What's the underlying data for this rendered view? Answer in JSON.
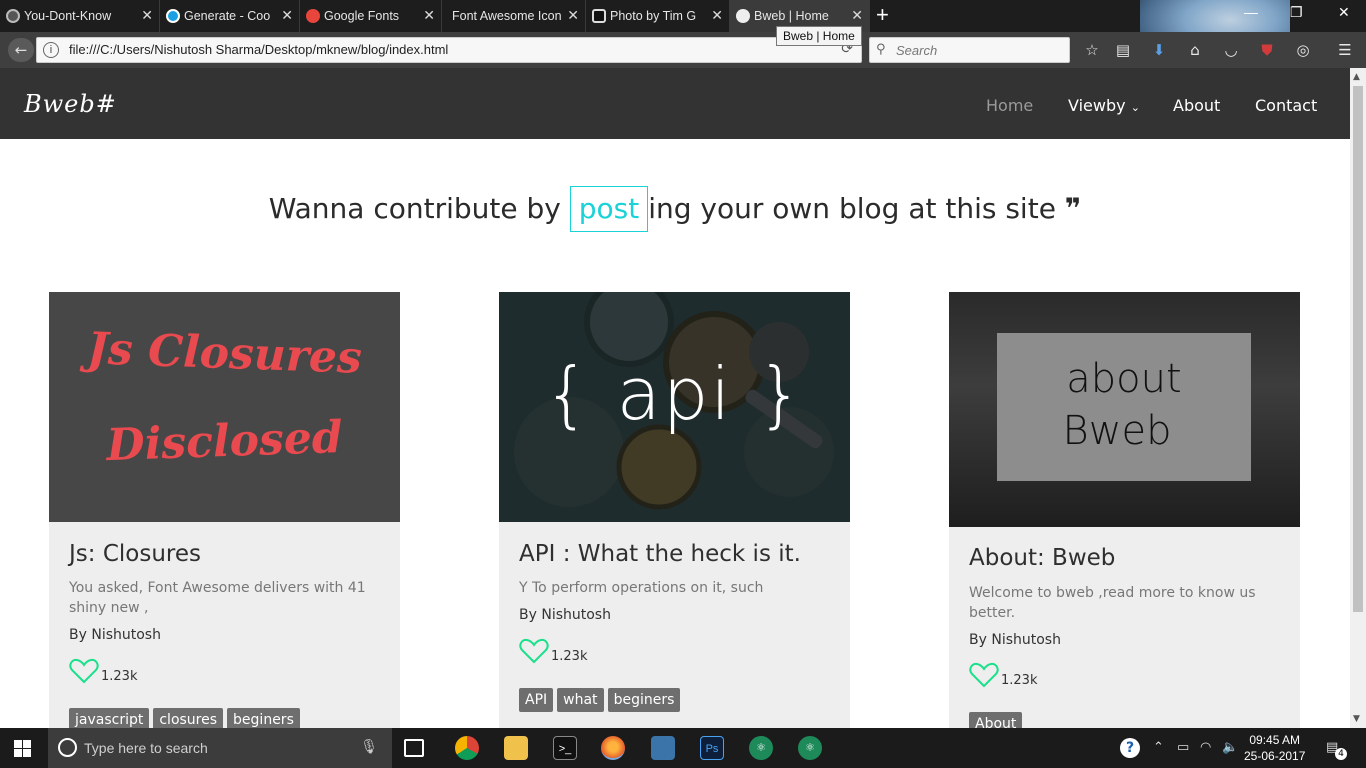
{
  "browser": {
    "tabs": [
      {
        "label": "You-Dont-Know",
        "favicon_color": "#222222"
      },
      {
        "label": "Generate - Coo",
        "favicon_color": "#1ba1e2"
      },
      {
        "label": "Google Fonts",
        "favicon_color": "#e8453c"
      },
      {
        "label": "Font Awesome Icon",
        "favicon_color": "#1d1d1d"
      },
      {
        "label": "Photo by Tim G",
        "favicon_color": "#111111"
      },
      {
        "label": "Bweb | Home",
        "favicon_color": "#eeeeee"
      }
    ],
    "new_tab": "+",
    "tooltip": "Bweb | Home",
    "url": "file:///C:/Users/Nishutosh Sharma/Desktop/mknew/blog/index.html",
    "search_placeholder": "Search",
    "window_controls": [
      "—",
      "❐",
      "✕"
    ]
  },
  "site": {
    "logo": "Bweb#",
    "menu": [
      "Home",
      "Viewby",
      "About",
      "Contact"
    ],
    "hero": {
      "before": "Wanna contribute by ",
      "highlight": "post",
      "after": "ing your own blog at this site ",
      "quote": "❞"
    },
    "accent": "#19d3d8",
    "cards": [
      {
        "image_text_1": "Js Closures",
        "image_text_2": "Disclosed",
        "title": "Js: Closures",
        "desc": "You asked, Font Awesome delivers with 41 shiny new ,",
        "author": "By Nishutosh",
        "likes": "1.23k",
        "tags": [
          "javascript",
          "closures",
          "beginers"
        ]
      },
      {
        "image_text_1": "{ api }",
        "title": "API : What the heck is it.",
        "desc": "Y To perform operations on it, such",
        "author": "By Nishutosh",
        "likes": "1.23k",
        "tags": [
          "API",
          "what",
          "beginers"
        ]
      },
      {
        "image_text_1": "about",
        "image_text_2": "Bweb",
        "title": "About: Bweb",
        "desc": "Welcome to bweb ,read more to know us better.",
        "author": "By Nishutosh",
        "likes": "1.23k",
        "tags": [
          "About"
        ]
      }
    ]
  },
  "taskbar": {
    "search_placeholder": "Type here to search",
    "time": "09:45 AM",
    "date": "25-06-2017",
    "notif_count": "4",
    "apps": [
      "chrome",
      "explorer",
      "cmd",
      "firefox",
      "python",
      "Ps",
      "atom",
      "atom"
    ]
  }
}
